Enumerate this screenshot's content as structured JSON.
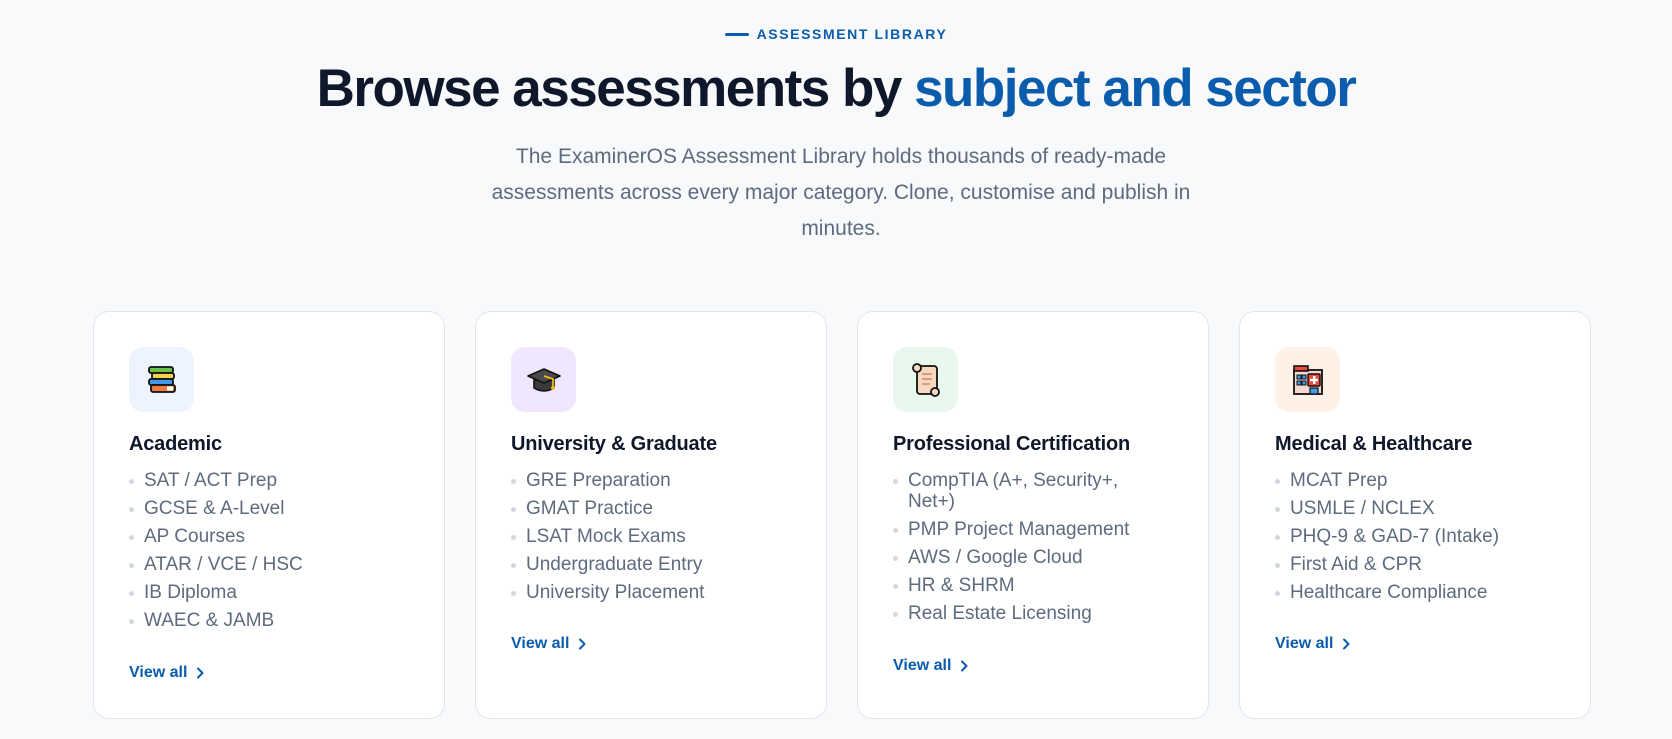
{
  "header": {
    "eyebrow": "ASSESSMENT LIBRARY",
    "title_main": "Browse assessments by ",
    "title_accent": "subject and sector",
    "description": "The ExaminerOS Assessment Library holds thousands of ready-made assessments across every major category. Clone, customise and publish in minutes."
  },
  "colors": {
    "accent": "#0b5cad",
    "heading": "#0f172a",
    "body_text": "#5e6b7f"
  },
  "categories": [
    {
      "icon": "books-icon",
      "icon_bg": "#eef4ff",
      "title": "Academic",
      "items": [
        "SAT / ACT Prep",
        "GCSE & A-Level",
        "AP Courses",
        "ATAR / VCE / HSC",
        "IB Diploma",
        "WAEC & JAMB"
      ],
      "link": "View all"
    },
    {
      "icon": "graduation-cap-icon",
      "icon_bg": "#f1e6ff",
      "title": "University & Graduate",
      "items": [
        "GRE Preparation",
        "GMAT Practice",
        "LSAT Mock Exams",
        "Undergraduate Entry",
        "University Placement"
      ],
      "link": "View all"
    },
    {
      "icon": "scroll-icon",
      "icon_bg": "#e8f8ef",
      "title": "Professional Certification",
      "items": [
        "CompTIA (A+, Security+, Net+)",
        "PMP Project Management",
        "AWS / Google Cloud",
        "HR & SHRM",
        "Real Estate Licensing"
      ],
      "link": "View all"
    },
    {
      "icon": "hospital-icon",
      "icon_bg": "#fff1e6",
      "title": "Medical & Healthcare",
      "items": [
        "MCAT Prep",
        "USMLE / NCLEX",
        "PHQ-9 & GAD-7 (Intake)",
        "First Aid & CPR",
        "Healthcare Compliance"
      ],
      "link": "View all"
    }
  ]
}
